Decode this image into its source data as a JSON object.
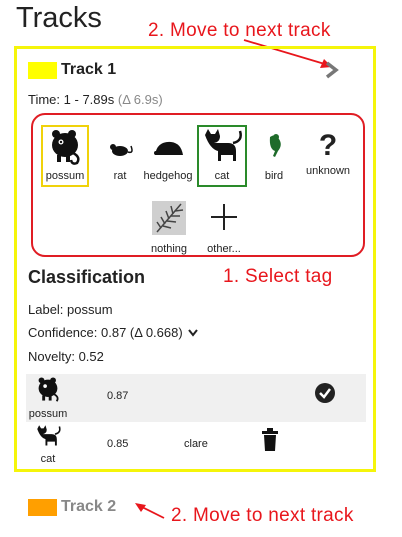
{
  "page_title": "Tracks",
  "annotations": {
    "move_next_top": "2.  Move to next track",
    "select_tag": "1. Select tag",
    "move_next_bottom": "2.  Move to next track"
  },
  "track1": {
    "name": "Track 1",
    "color": "#ffff00",
    "time_label": "Time:",
    "time_value": "1 - 7.89s",
    "time_delta": "(Δ 6.9s)"
  },
  "tags": [
    {
      "label": "possum",
      "icon": "possum-icon",
      "selected": "yellow"
    },
    {
      "label": "rat",
      "icon": "rat-icon"
    },
    {
      "label": "hedgehog",
      "icon": "hedgehog-icon"
    },
    {
      "label": "cat",
      "icon": "cat-icon",
      "selected": "green"
    },
    {
      "label": "bird",
      "icon": "bird-icon"
    },
    {
      "label": "unknown",
      "icon": "question-icon"
    },
    {
      "label": "nothing",
      "icon": "fern-icon"
    },
    {
      "label": "other...",
      "icon": "plus-icon"
    }
  ],
  "classification": {
    "heading": "Classification",
    "label_line": "Label: possum",
    "confidence_line": "Confidence: 0.87 (Δ 0.668)",
    "novelty_line": "Novelty: 0.52",
    "rows": [
      {
        "tag": "possum",
        "score": "0.87",
        "user": "",
        "action": "check-icon"
      },
      {
        "tag": "cat",
        "score": "0.85",
        "user": "clare",
        "action": "trash-icon"
      }
    ]
  },
  "track2": {
    "name": "Track 2",
    "color": "#ff9f00"
  },
  "colors": {
    "annotation_red": "#e8161c",
    "highlight_yellow": "#f5f50a",
    "select_green": "#2a8a2a"
  }
}
